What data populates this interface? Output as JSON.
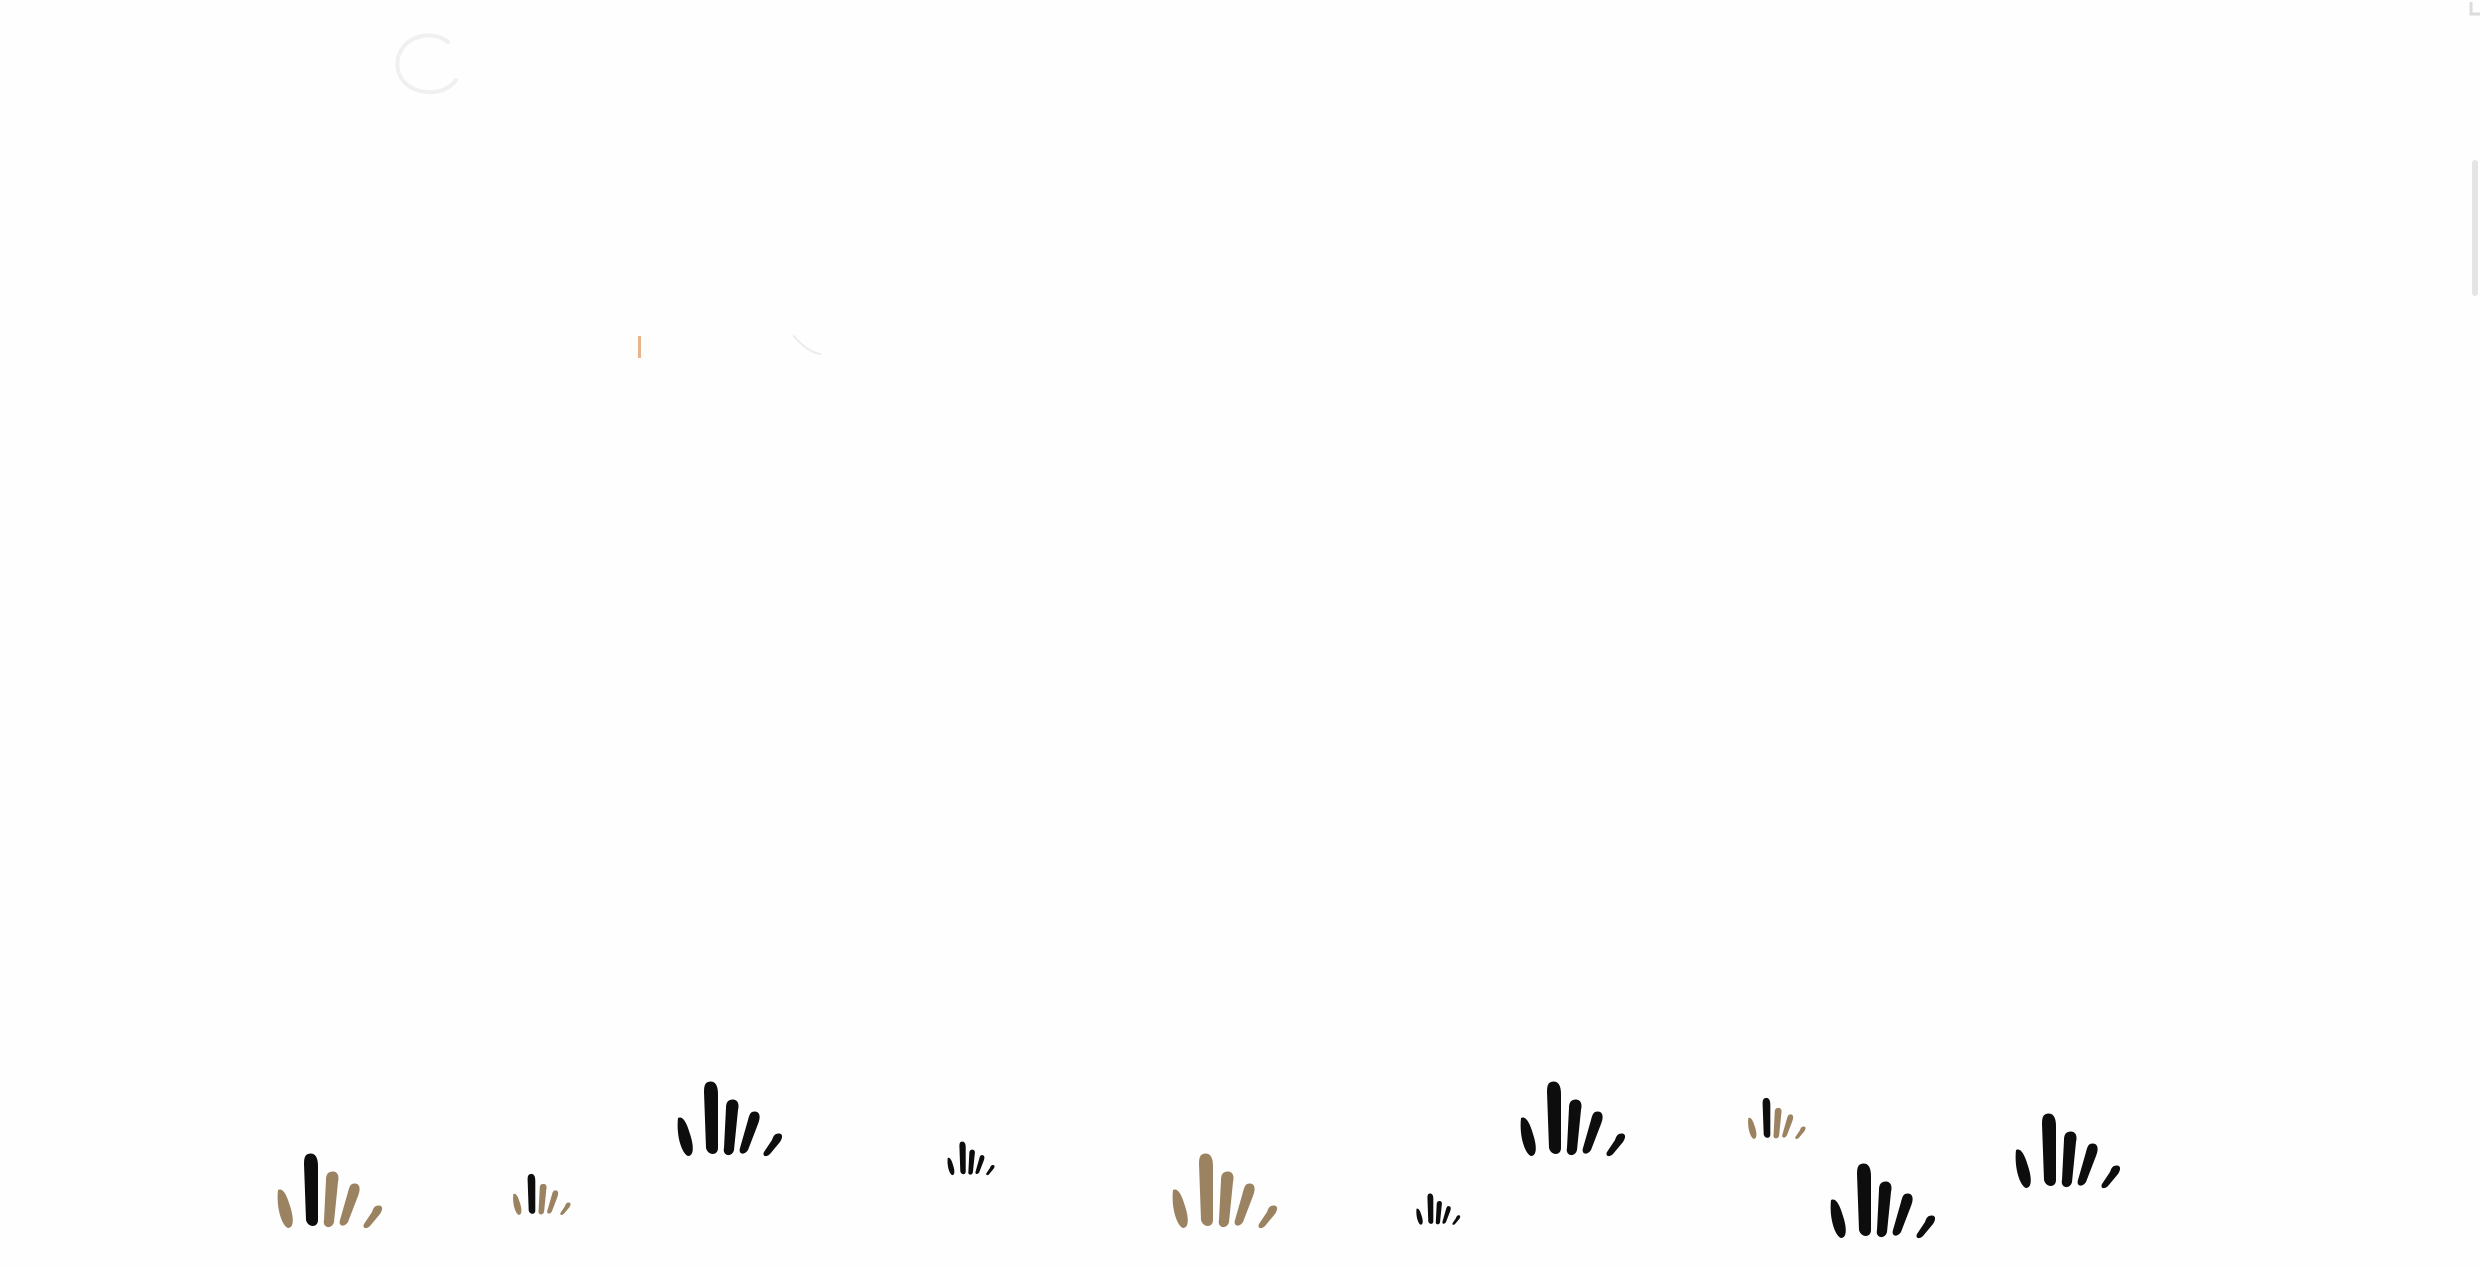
{
  "brand": {
    "name": "",
    "logo_icon": "circle-logo-mark"
  },
  "nav": {
    "items": []
  },
  "colors": {
    "dark_grass": "#0d0d0d",
    "tan_grass": "#9b8361",
    "hero_accent": "#e7b48e"
  },
  "decor": {
    "grass_icon": "grass-tuft-icon"
  }
}
